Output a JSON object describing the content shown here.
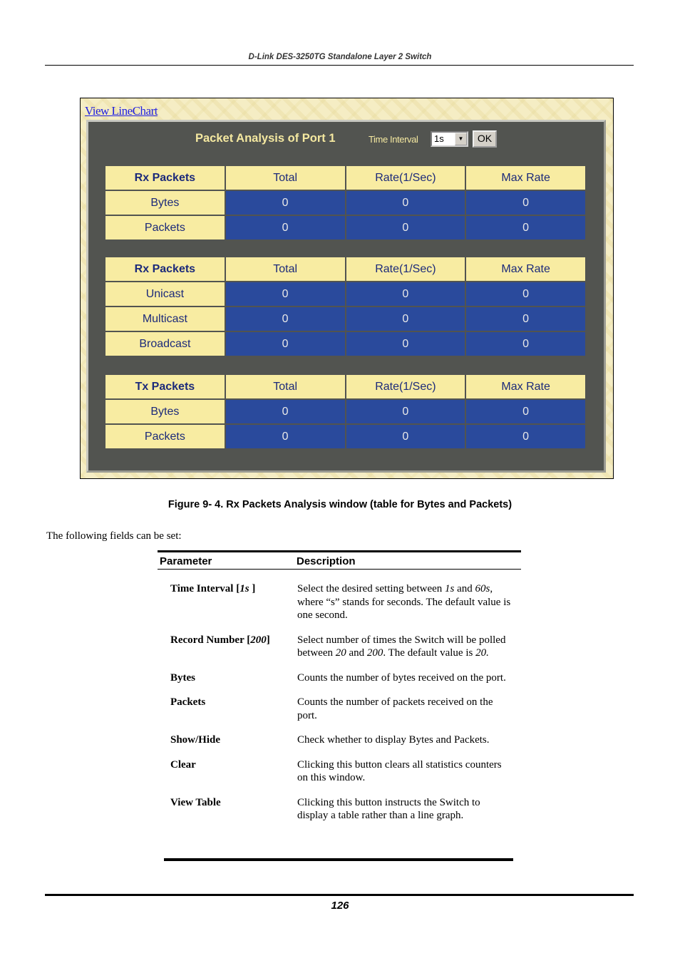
{
  "header": {
    "title": "D-Link DES-3250TG Standalone Layer 2 Switch"
  },
  "screenshot": {
    "link_label": "View LineChart",
    "panel_title": "Packet Analysis of Port 1",
    "time_interval_label": "Time Interval",
    "time_interval_value": "1s",
    "ok_label": "OK",
    "colors": {
      "panel_bg": "#525450",
      "header_cell": "#f8eca2",
      "value_cell": "#2a4a9c",
      "title_text": "#f4e8a0"
    },
    "tables": [
      {
        "headers": [
          "Rx Packets",
          "Total",
          "Rate(1/Sec)",
          "Max Rate"
        ],
        "rows": [
          {
            "label": "Bytes",
            "values": [
              "0",
              "0",
              "0"
            ]
          },
          {
            "label": "Packets",
            "values": [
              "0",
              "0",
              "0"
            ]
          }
        ]
      },
      {
        "headers": [
          "Rx Packets",
          "Total",
          "Rate(1/Sec)",
          "Max Rate"
        ],
        "rows": [
          {
            "label": "Unicast",
            "values": [
              "0",
              "0",
              "0"
            ]
          },
          {
            "label": "Multicast",
            "values": [
              "0",
              "0",
              "0"
            ]
          },
          {
            "label": "Broadcast",
            "values": [
              "0",
              "0",
              "0"
            ]
          }
        ]
      },
      {
        "headers": [
          "Tx Packets",
          "Total",
          "Rate(1/Sec)",
          "Max Rate"
        ],
        "rows": [
          {
            "label": "Bytes",
            "values": [
              "0",
              "0",
              "0"
            ]
          },
          {
            "label": "Packets",
            "values": [
              "0",
              "0",
              "0"
            ]
          }
        ]
      }
    ]
  },
  "caption": "Figure 9- 4.  Rx Packets Analysis window (table for Bytes and Packets)",
  "intro": "The following fields can be set:",
  "params": {
    "headers": [
      "Parameter",
      "Description"
    ],
    "rows": [
      {
        "name_html": "Time Interval [<i>1s</i> ]",
        "desc_html": "Select the desired setting between <i>1s</i> and <i>60s</i>, where “s” stands for seconds. The default value is one second."
      },
      {
        "name_html": "Record Number [<i>200</i>]",
        "desc_html": "Select number of times the Switch will be polled between <i>20</i> and <i>200</i>. The default value is <i>20.</i>"
      },
      {
        "name_html": "Bytes",
        "desc_html": "Counts the number of bytes received on the port."
      },
      {
        "name_html": "Packets",
        "desc_html": "Counts the number of packets received on the port."
      },
      {
        "name_html": "Show/Hide",
        "desc_html": "Check whether to display Bytes and Packets."
      },
      {
        "name_html": "Clear",
        "desc_html": "Clicking this button clears all statistics counters on this window."
      },
      {
        "name_html": "View Table",
        "desc_html": "Clicking this button instructs the Switch to display a table rather than a line graph."
      }
    ]
  },
  "footer": {
    "page_number": "126"
  }
}
